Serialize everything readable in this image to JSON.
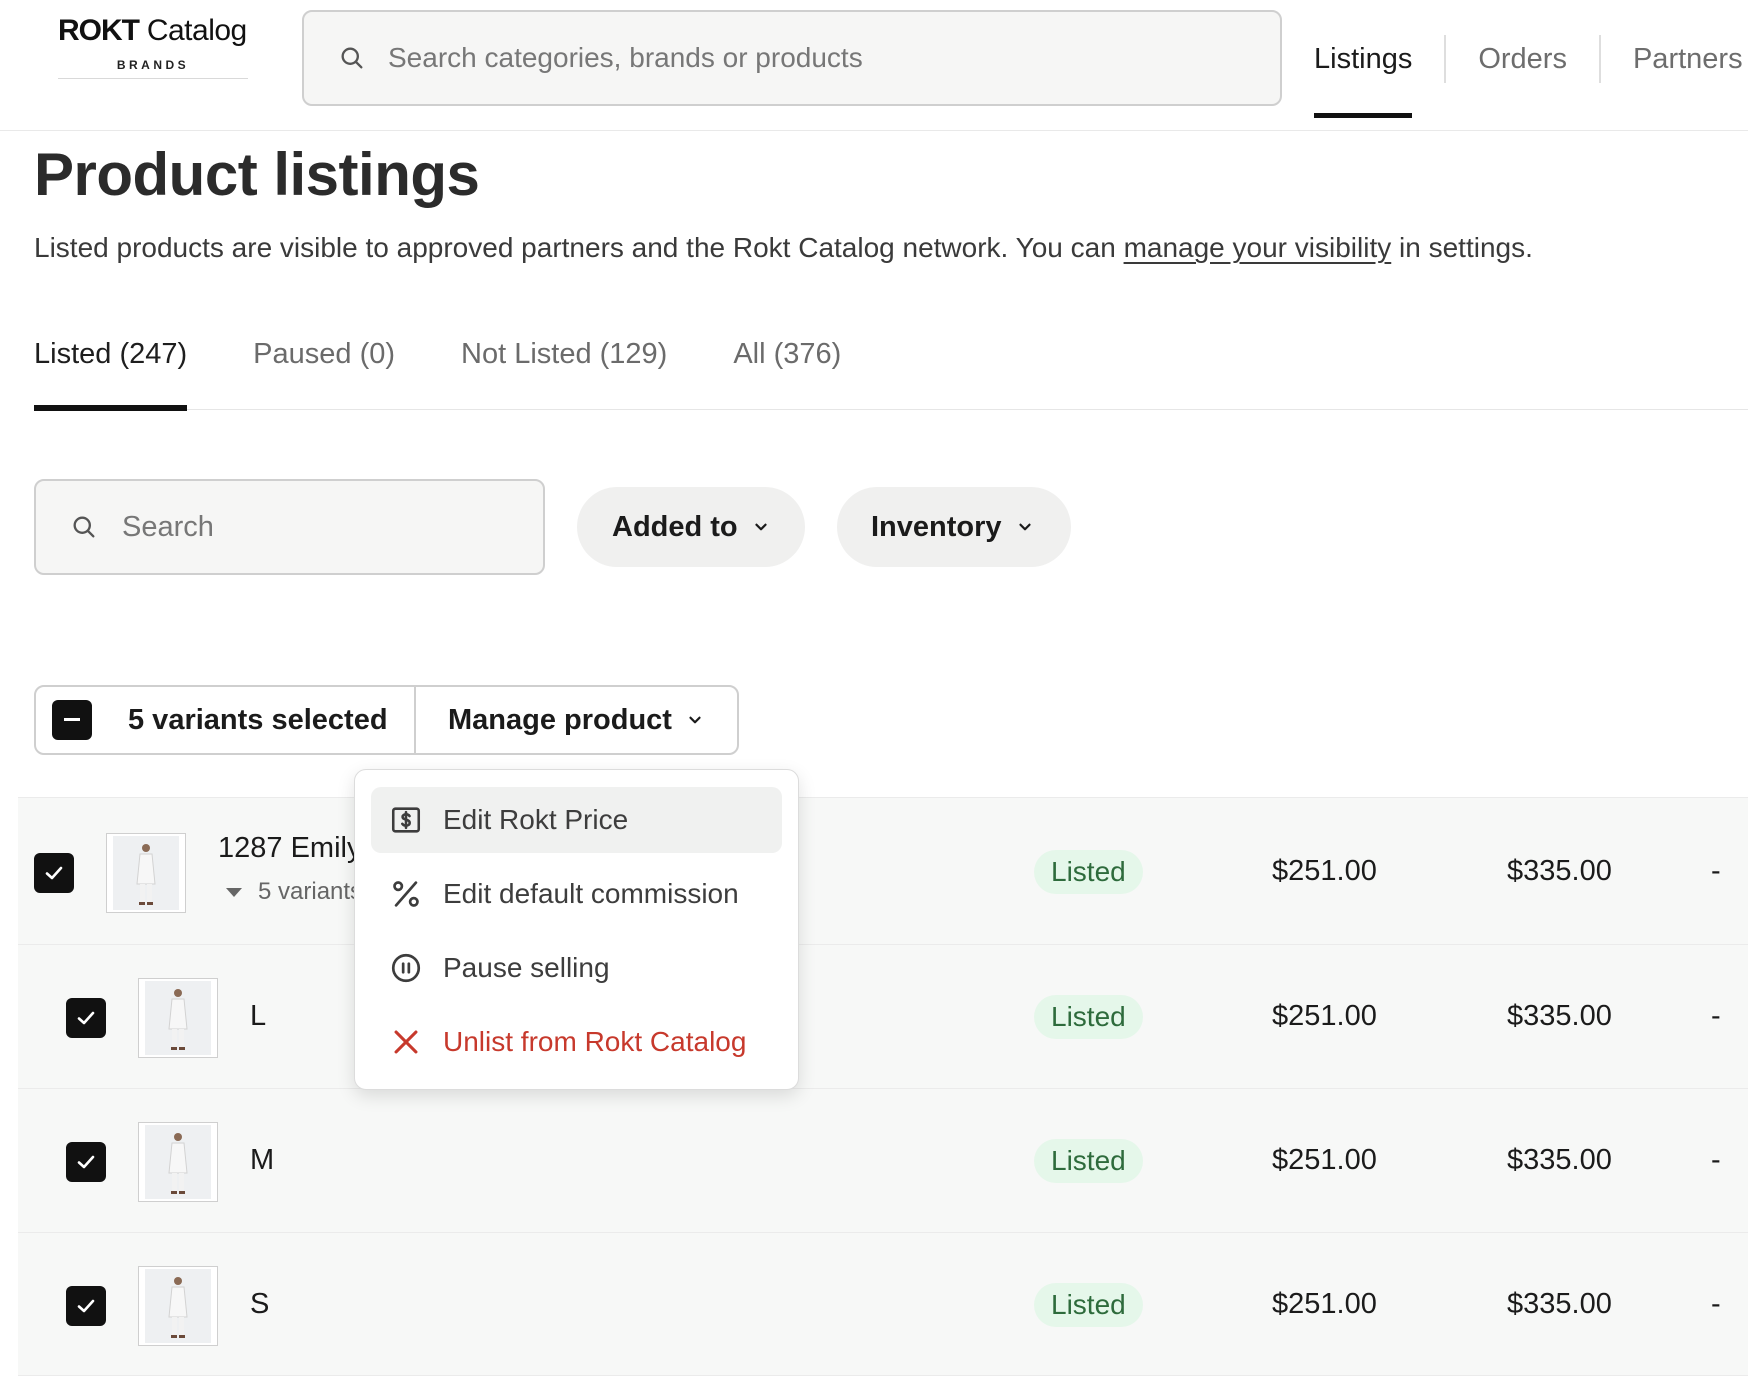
{
  "header": {
    "logo_main_bold": "ROKT",
    "logo_main_rest": " Catalog",
    "logo_sub": "BRANDS",
    "search_placeholder": "Search categories, brands or products",
    "nav": [
      "Listings",
      "Orders",
      "Partners"
    ],
    "active_nav": "Listings"
  },
  "page": {
    "title": "Product listings",
    "desc_before": "Listed products are visible to approved partners and the Rokt Catalog network. You can ",
    "desc_link": "manage your visibility",
    "desc_after": " in settings."
  },
  "tabs": [
    "Listed (247)",
    "Paused (0)",
    "Not Listed (129)",
    "All (376)"
  ],
  "active_tab": "Listed (247)",
  "filters": {
    "search_placeholder": "Search",
    "added_to": "Added to",
    "inventory": "Inventory"
  },
  "bulk": {
    "selected_label": "5 variants selected",
    "manage_label": "Manage product"
  },
  "menu": {
    "items": [
      {
        "label": "Edit Rokt Price",
        "icon": "dollar-tag-icon"
      },
      {
        "label": "Edit default commission",
        "icon": "percent-icon"
      },
      {
        "label": "Pause selling",
        "icon": "pause-circle-icon"
      },
      {
        "label": "Unlist from Rokt Catalog",
        "icon": "close-icon",
        "color": "#c7392c"
      }
    ]
  },
  "rows": [
    {
      "name": "1287 Emily",
      "variants": "5 variants",
      "status": "Listed",
      "price1": "$251.00",
      "price2": "$335.00",
      "extra": "-"
    },
    {
      "name": "L",
      "status": "Listed",
      "price1": "$251.00",
      "price2": "$335.00",
      "extra": "-"
    },
    {
      "name": "M",
      "status": "Listed",
      "price1": "$251.00",
      "price2": "$335.00",
      "extra": "-"
    },
    {
      "name": "S",
      "status": "Listed",
      "price1": "$251.00",
      "price2": "$335.00",
      "extra": "-"
    }
  ],
  "colors": {
    "accent": "#111111",
    "status_bg": "#e5f7ea",
    "status_text": "#2e6b3c",
    "danger": "#c7392c"
  }
}
